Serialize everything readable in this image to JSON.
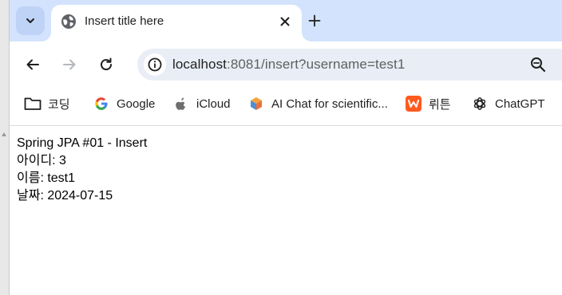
{
  "tab": {
    "title": "Insert title here",
    "favicon": "globe-icon"
  },
  "toolbar": {
    "url_host": "localhost",
    "url_path": ":8081/insert?username=test1"
  },
  "bookmarks": [
    {
      "label": "코딩",
      "icon": "folder-icon"
    },
    {
      "label": "Google",
      "icon": "google-icon"
    },
    {
      "label": "iCloud",
      "icon": "apple-icon"
    },
    {
      "label": "AI Chat for scientific...",
      "icon": "scispace-icon"
    },
    {
      "label": "뤼튼",
      "icon": "wrtn-icon"
    },
    {
      "label": "ChatGPT",
      "icon": "chatgpt-icon"
    }
  ],
  "page": {
    "heading": "Spring JPA #01 - Insert",
    "id_line": "아이디: 3",
    "name_line": "이름: test1",
    "date_line": "날짜: 2024-07-15"
  },
  "colors": {
    "tabstrip": "#d3e3fd",
    "omnibox": "#e9eef6",
    "wrtn": "#ff5a1f"
  }
}
